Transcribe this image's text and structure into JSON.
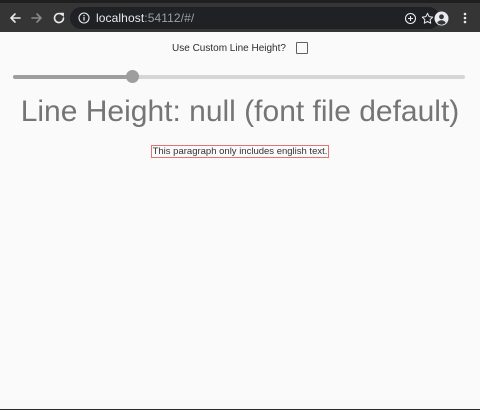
{
  "browser": {
    "url_host": "localhost",
    "url_rest": ":54112/#/"
  },
  "app": {
    "toggle_label": "Use Custom Line Height?",
    "toggle_checked": false,
    "slider_value_fraction": 0.265,
    "heading": "Line Height: null (font file default)",
    "paragraph": "This paragraph only includes english text."
  }
}
